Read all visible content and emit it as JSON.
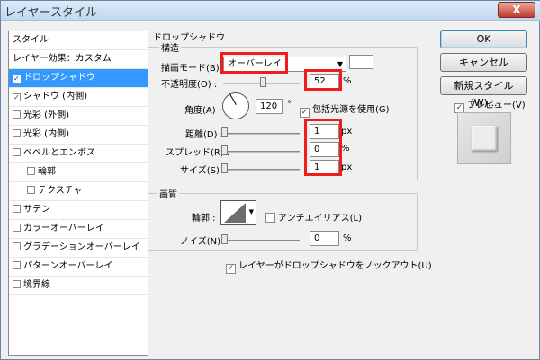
{
  "window": {
    "title": "レイヤースタイル",
    "close_label": "X"
  },
  "left_panel": {
    "header": "スタイル",
    "items": [
      {
        "label": "レイヤー効果：カスタム",
        "checkbox": false,
        "checked": false,
        "selected": false
      },
      {
        "label": "ドロップシャドウ",
        "checkbox": true,
        "checked": true,
        "selected": true
      },
      {
        "label": "シャドウ (内側)",
        "checkbox": true,
        "checked": true,
        "selected": false
      },
      {
        "label": "光彩 (外側)",
        "checkbox": true,
        "checked": false,
        "selected": false
      },
      {
        "label": "光彩 (内側)",
        "checkbox": true,
        "checked": false,
        "selected": false
      },
      {
        "label": "ベベルとエンボス",
        "checkbox": true,
        "checked": false,
        "selected": false
      },
      {
        "label": "輪郭",
        "checkbox": true,
        "checked": false,
        "selected": false,
        "indent": true
      },
      {
        "label": "テクスチャ",
        "checkbox": true,
        "checked": false,
        "selected": false,
        "indent": true
      },
      {
        "label": "サテン",
        "checkbox": true,
        "checked": false,
        "selected": false
      },
      {
        "label": "カラーオーバーレイ",
        "checkbox": true,
        "checked": false,
        "selected": false
      },
      {
        "label": "グラデーションオーバーレイ",
        "checkbox": true,
        "checked": false,
        "selected": false
      },
      {
        "label": "パターンオーバーレイ",
        "checkbox": true,
        "checked": false,
        "selected": false
      },
      {
        "label": "境界線",
        "checkbox": true,
        "checked": false,
        "selected": false
      }
    ]
  },
  "drop_shadow": {
    "section_title": "ドロップシャドウ",
    "structure_title": "構造",
    "blend_mode_label": "描画モード(B) :",
    "blend_mode_value": "オーバーレイ",
    "opacity_label": "不透明度(O) :",
    "opacity_value": "52",
    "opacity_unit": "%",
    "opacity_level": 0.52,
    "angle_label": "角度(A) :",
    "angle_value": "120",
    "angle_unit": "°",
    "global_light_label": "包括光源を使用(G)",
    "global_light_checked": true,
    "distance_label": "距離(D) :",
    "distance_value": "1",
    "distance_unit": "px",
    "spread_label": "スプレッド(R) :",
    "spread_value": "0",
    "spread_unit": "%",
    "size_label": "サイズ(S) :",
    "size_value": "1",
    "size_unit": "px",
    "quality_title": "画質",
    "contour_label": "輪郭 :",
    "antialias_label": "アンチエイリアス(L)",
    "antialias_checked": false,
    "noise_label": "ノイズ(N) :",
    "noise_value": "0",
    "noise_unit": "%",
    "knockout_label": "レイヤーがドロップシャドウをノックアウト(U)",
    "knockout_checked": true
  },
  "buttons": {
    "ok": "OK",
    "cancel": "キャンセル",
    "new_style": "新規スタイル(W)...",
    "preview_label": "プレビュー(V)",
    "preview_checked": true
  },
  "colors": {
    "highlight": "#3399ff",
    "annotation_red": "#ee1c1c"
  }
}
